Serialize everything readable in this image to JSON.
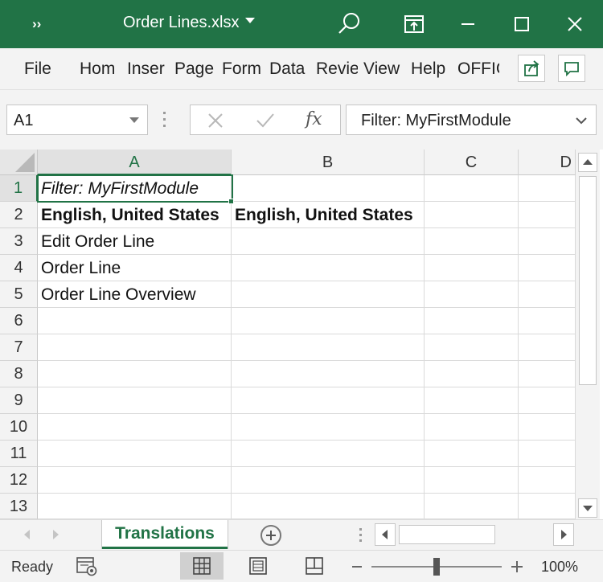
{
  "titlebar": {
    "more_label": "››",
    "file_title": "Order Lines.xlsx",
    "accent_color": "#217346"
  },
  "ribbon": {
    "tabs": [
      "File",
      "Hom",
      "Inser",
      "Page",
      "Form",
      "Data",
      "Revie",
      "View",
      "Help",
      "OFFIC"
    ],
    "share_icon": "share-icon",
    "comments_icon": "comment-icon"
  },
  "formula_bar": {
    "name_box": "A1",
    "fx_label": "fx",
    "content": "Filter: MyFirstModule"
  },
  "sheet": {
    "active_cell": "A1",
    "columns": [
      "A",
      "B",
      "C",
      "D"
    ],
    "rows": [
      "1",
      "2",
      "3",
      "4",
      "5",
      "6",
      "7",
      "8",
      "9",
      "10",
      "11",
      "12",
      "13"
    ],
    "cells": {
      "A1": "Filter: MyFirstModule",
      "A2": "English, United States",
      "B2": "English, United States",
      "A3": "Edit Order Line",
      "A4": "Order Line",
      "A5": "Order Line Overview"
    }
  },
  "sheet_tabs": {
    "active": "Translations"
  },
  "status": {
    "ready": "Ready",
    "zoom": "100%",
    "zoom_level": 1.0
  }
}
